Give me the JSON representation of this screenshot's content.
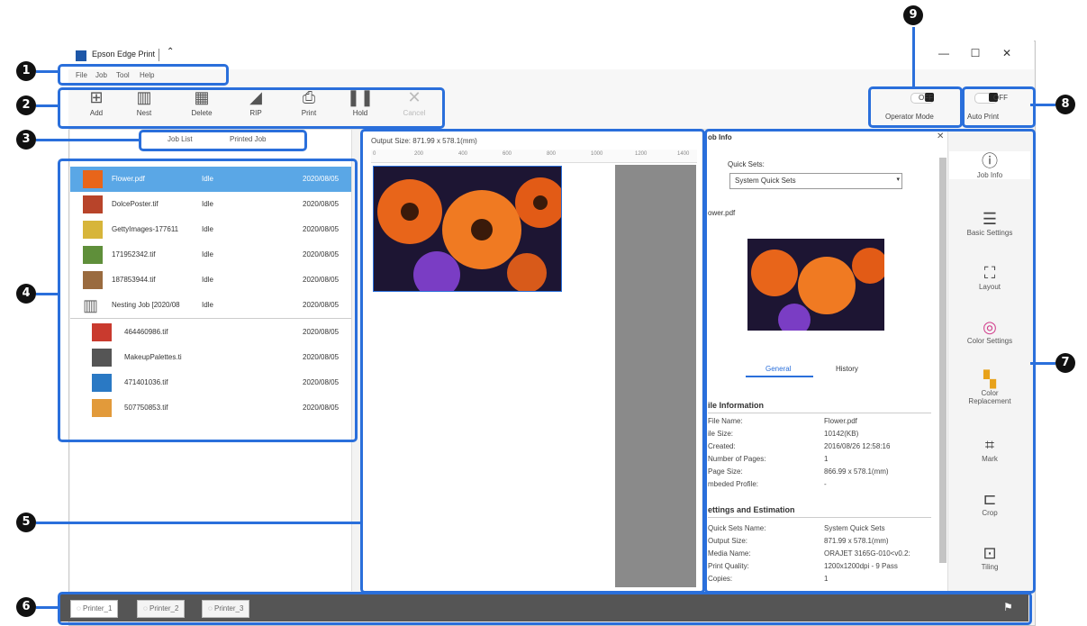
{
  "app": {
    "title": "Epson Edge Print",
    "minimize": "—",
    "maximize": "☐",
    "close": "✕"
  },
  "menu": [
    "File",
    "Job",
    "Tool",
    "Help"
  ],
  "toolbar": {
    "buttons": [
      {
        "label": "Add",
        "icon": "add-icon"
      },
      {
        "label": "Nest",
        "icon": "nest-icon"
      },
      {
        "label": "Delete",
        "icon": "delete-icon"
      },
      {
        "label": "RIP",
        "icon": "rip-icon"
      },
      {
        "label": "Print",
        "icon": "print-icon"
      },
      {
        "label": "Hold",
        "icon": "hold-icon"
      },
      {
        "label": "Cancel",
        "icon": "cancel-icon"
      }
    ],
    "operator_mode": {
      "state": "OFF",
      "label": "Operator Mode"
    },
    "auto_print": {
      "state": "OFF",
      "label": "Auto Print"
    }
  },
  "job_tabs": [
    "Job List",
    "Printed Job"
  ],
  "jobs": [
    {
      "name": "Flower.pdf",
      "status": "Idle",
      "date": "2020/08/05",
      "selected": true
    },
    {
      "name": "DolcePoster.tif",
      "status": "Idle",
      "date": "2020/08/05"
    },
    {
      "name": "GettyImages-177611",
      "status": "Idle",
      "date": "2020/08/05"
    },
    {
      "name": "171952342.tif",
      "status": "Idle",
      "date": "2020/08/05"
    },
    {
      "name": "187853944.tif",
      "status": "Idle",
      "date": "2020/08/05"
    },
    {
      "name": "Nesting Job [2020/08",
      "status": "Idle",
      "date": "2020/08/05"
    }
  ],
  "nested_jobs": [
    {
      "name": "464460986.tif",
      "date": "2020/08/05"
    },
    {
      "name": "MakeupPalettes.ti",
      "date": "2020/08/05"
    },
    {
      "name": "471401036.tif",
      "date": "2020/08/05"
    },
    {
      "name": "507750853.tif",
      "date": "2020/08/05"
    }
  ],
  "preview": {
    "output_size": "Output Size:  871.99 x 578.1(mm)",
    "ruler": [
      "0",
      "200",
      "400",
      "600",
      "800",
      "1000",
      "1200",
      "1400"
    ]
  },
  "job_info": {
    "header": "ob Info",
    "quick_sets_label": "Quick Sets:",
    "quick_sets_value": "System Quick Sets",
    "file_label": "ower.pdf",
    "tabs": [
      "General",
      "History"
    ],
    "file_information_title": "ile Information",
    "file_information": [
      {
        "k": "File Name:",
        "v": "Flower.pdf"
      },
      {
        "k": "ile Size:",
        "v": "10142(KB)"
      },
      {
        "k": "Created:",
        "v": "2016/08/26 12:58:16"
      },
      {
        "k": "Number of Pages:",
        "v": "1"
      },
      {
        "k": "Page Size:",
        "v": "866.99 x 578.1(mm)"
      },
      {
        "k": "mbeded Profile:",
        "v": "-"
      }
    ],
    "settings_title": "ettings and Estimation",
    "settings": [
      {
        "k": "Quick Sets Name:",
        "v": "System Quick Sets"
      },
      {
        "k": "Output Size:",
        "v": "871.99 x 578.1(mm)"
      },
      {
        "k": "Media Name:",
        "v": "ORAJET 3165G-010<v0.2:"
      },
      {
        "k": "Print Quality:",
        "v": "1200x1200dpi - 9 Pass"
      },
      {
        "k": "Copies:",
        "v": "1"
      }
    ]
  },
  "side_panel": [
    {
      "label": "Job Info",
      "icon": "info-icon"
    },
    {
      "label": "Basic Settings",
      "icon": "list-icon"
    },
    {
      "label": "Layout",
      "icon": "layout-icon"
    },
    {
      "label": "Color Settings",
      "icon": "color-wheel-icon"
    },
    {
      "label": "Color Replacement",
      "icon": "palette-icon"
    },
    {
      "label": "Mark",
      "icon": "mark-icon"
    },
    {
      "label": "Crop",
      "icon": "crop-icon"
    },
    {
      "label": "Tiling",
      "icon": "tiling-icon"
    }
  ],
  "printers": [
    "Printer_1",
    "Printer_2",
    "Printer_3"
  ],
  "callouts": [
    "1",
    "2",
    "3",
    "4",
    "5",
    "6",
    "7",
    "8",
    "9"
  ],
  "colors": {
    "accent": "#2a6fdb",
    "selection": "#5aa7e6",
    "flower": "#e8651a"
  }
}
